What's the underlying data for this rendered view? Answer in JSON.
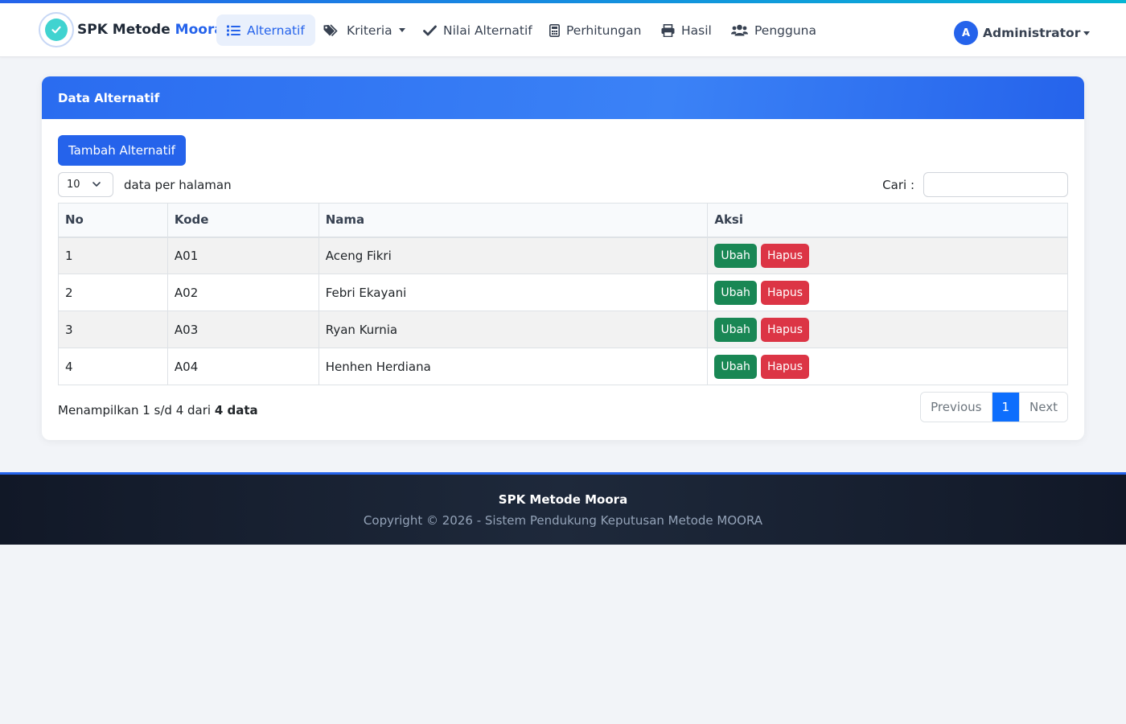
{
  "brand": {
    "name": "SPK Metode",
    "accent": "Moora"
  },
  "nav": {
    "alternatif": "Alternatif",
    "kriteria": "Kriteria",
    "nilai": "Nilai Alternatif",
    "perhitungan": "Perhitungan",
    "hasil": "Hasil",
    "pengguna": "Pengguna"
  },
  "user": {
    "initial": "A",
    "name": "Administrator"
  },
  "card": {
    "title": "Data Alternatif",
    "add_button": "Tambah Alternatif",
    "page_length": "10",
    "page_length_label": "data per halaman",
    "search_label": "Cari :",
    "search_value": ""
  },
  "table": {
    "headers": [
      "No",
      "Kode",
      "Nama",
      "Aksi"
    ],
    "rows": [
      {
        "no": "1",
        "kode": "A01",
        "nama": "Aceng Fikri"
      },
      {
        "no": "2",
        "kode": "A02",
        "nama": "Febri Ekayani"
      },
      {
        "no": "3",
        "kode": "A03",
        "nama": "Ryan Kurnia"
      },
      {
        "no": "4",
        "kode": "A04",
        "nama": "Henhen Herdiana"
      }
    ],
    "edit_label": "Ubah",
    "delete_label": "Hapus"
  },
  "info": {
    "prefix": "Menampilkan 1 s/d 4 dari",
    "bold": "4 data"
  },
  "pagination": {
    "previous": "Previous",
    "current": "1",
    "next": "Next"
  },
  "footer": {
    "title": "SPK Metode Moora",
    "copyright": "Copyright © 2026 - Sistem Pendukung Keputusan Metode MOORA"
  },
  "colors": {
    "primary": "#2563eb",
    "success": "#198754",
    "danger": "#dc3545",
    "footer_bg": "#111827"
  },
  "icons": [
    "check-circle-icon",
    "list-icon",
    "tags-icon",
    "check-icon",
    "calculator-icon",
    "print-icon",
    "users-icon",
    "chevron-down-icon"
  ]
}
